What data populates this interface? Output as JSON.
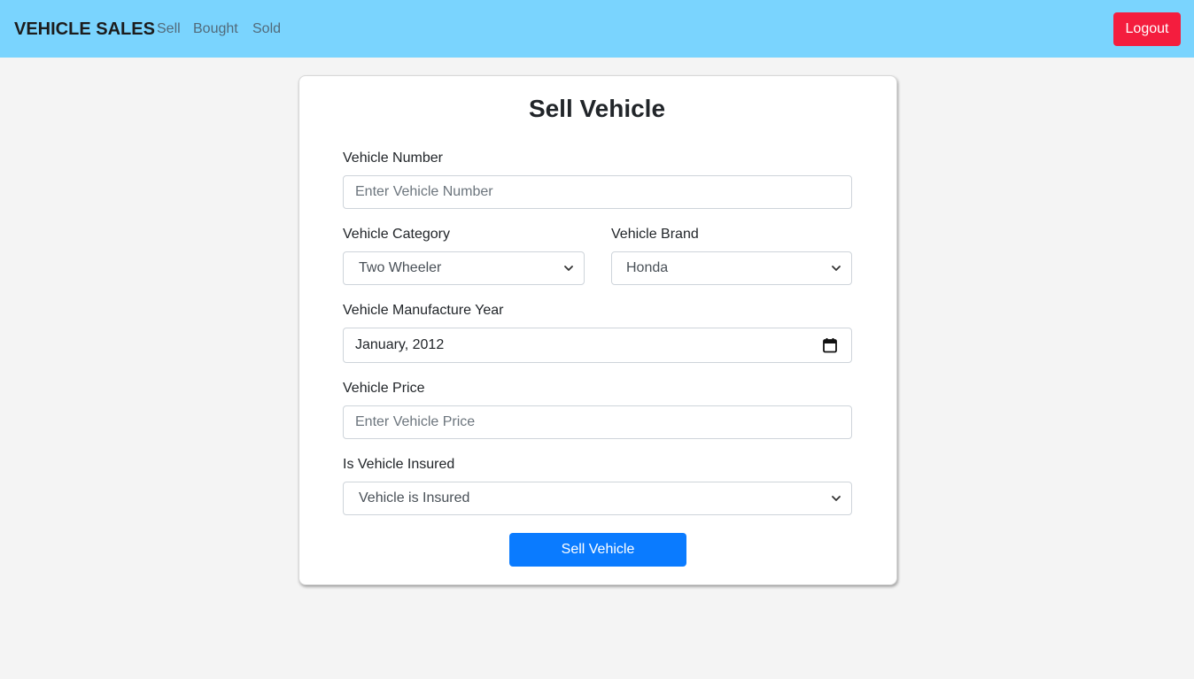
{
  "navbar": {
    "brand": "VEHICLE SALES",
    "links": [
      "Sell",
      "Bought",
      "Sold"
    ],
    "logout_label": "Logout",
    "bg_color": "#7ad4fe",
    "logout_color": "#f41d3e"
  },
  "form": {
    "title": "Sell Vehicle",
    "vehicle_number": {
      "label": "Vehicle Number",
      "value": "",
      "placeholder": "Enter Vehicle Number"
    },
    "vehicle_category": {
      "label": "Vehicle Category",
      "selected": "Two Wheeler"
    },
    "vehicle_brand": {
      "label": "Vehicle Brand",
      "selected": "Honda"
    },
    "manufacture_year": {
      "label": "Vehicle Manufacture Year",
      "value": "January, 2012",
      "icon": "calendar-icon"
    },
    "vehicle_price": {
      "label": "Vehicle Price",
      "value": "",
      "placeholder": "Enter Vehicle Price"
    },
    "is_insured": {
      "label": "Is Vehicle Insured",
      "selected": "Vehicle is Insured"
    },
    "submit_label": "Sell Vehicle",
    "submit_color": "#0a7bff"
  }
}
